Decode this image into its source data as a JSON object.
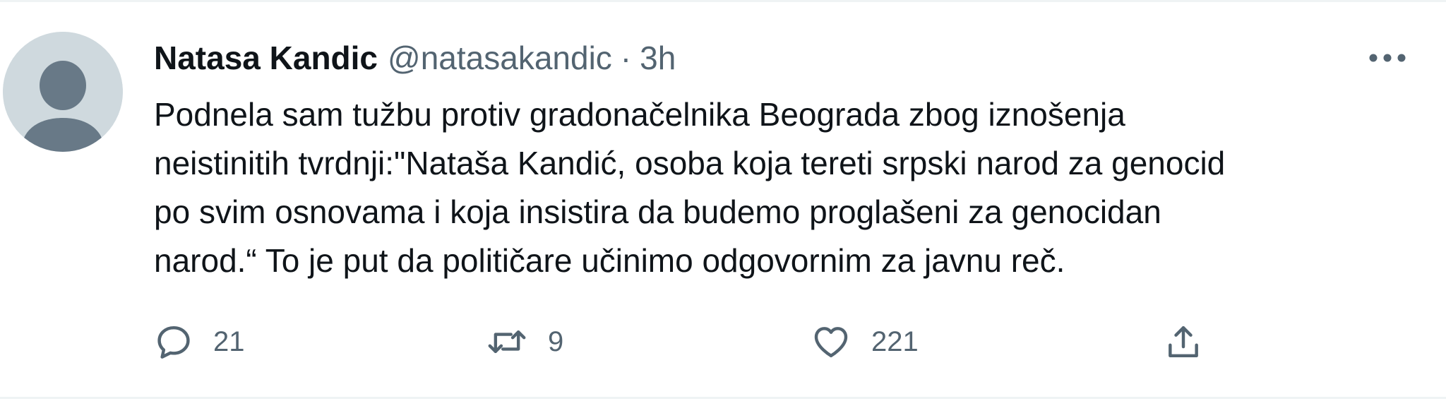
{
  "tweet": {
    "author": {
      "name": "Natasa Kandic",
      "handle": "@natasakandic",
      "separator": "·",
      "time": "3h",
      "avatar_icon": "default-avatar-icon"
    },
    "more_icon": "more-horizontal-icon",
    "text_lines": [
      "Podnela sam tužbu protiv gradonačelnika Beograda zbog iznošenja",
      "neistinitih tvrdnji:\"Nataša Kandić, osoba koja tereti srpski narod za genocid",
      "po svim osnovama i koja insistira da budemo proglašeni za genocidan",
      "narod.“ To je put da političare učinimo odgovornim za javnu reč."
    ],
    "actions": {
      "reply": {
        "icon": "reply-icon",
        "count": "21"
      },
      "retweet": {
        "icon": "retweet-icon",
        "count": "9"
      },
      "like": {
        "icon": "heart-icon",
        "count": "221"
      },
      "share": {
        "icon": "share-icon",
        "count": ""
      }
    },
    "colors": {
      "text": "#0f1419",
      "secondary": "#536471",
      "avatar_bg": "#cfd9de",
      "avatar_fg": "#687987",
      "divider": "#eff3f4"
    }
  }
}
